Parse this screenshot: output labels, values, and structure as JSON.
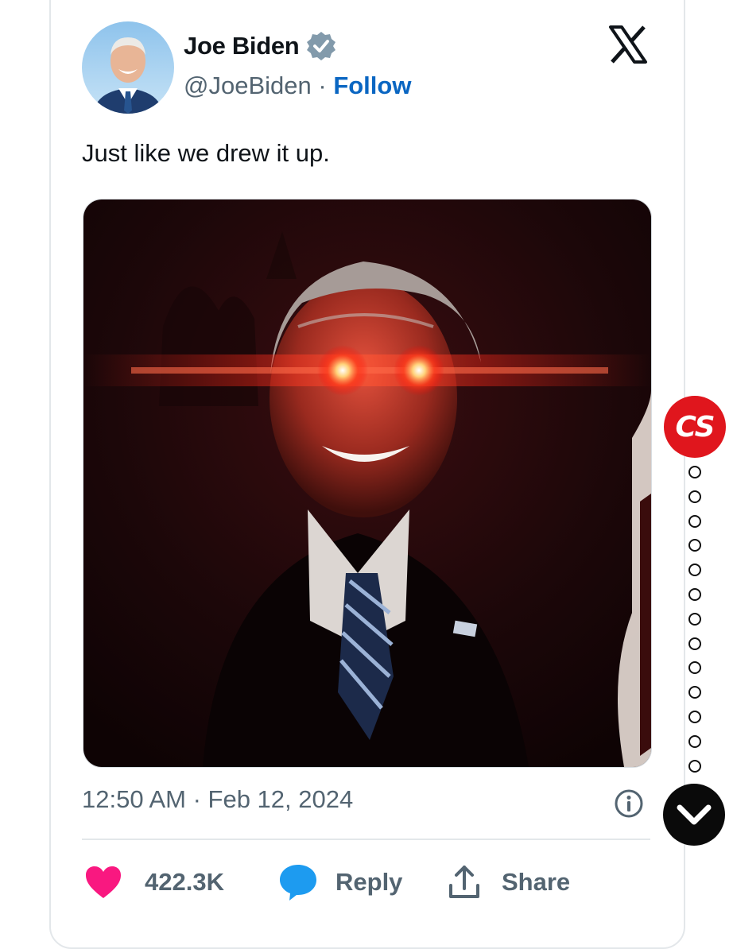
{
  "tweet": {
    "author_name": "Joe Biden",
    "handle": "@JoeBiden",
    "separator": "·",
    "follow_label": "Follow",
    "text": "Just like we drew it up.",
    "timestamp": "12:50 AM · Feb 12, 2024"
  },
  "actions": {
    "like_count": "422.3K",
    "reply_label": "Reply",
    "share_label": "Share"
  },
  "widget": {
    "badge_text": "CS",
    "dot_count": 13
  },
  "icons": {
    "verified": "verified-badge-icon",
    "platform": "x-logo-icon",
    "info": "info-icon",
    "like": "heart-icon",
    "reply": "speech-bubble-icon",
    "share": "share-upload-icon",
    "scroll": "chevron-down-icon"
  },
  "colors": {
    "like": "#f91880",
    "reply": "#1d9bf0",
    "follow": "#0a66c2",
    "verified": "#829aab",
    "badge": "#e0161d"
  }
}
